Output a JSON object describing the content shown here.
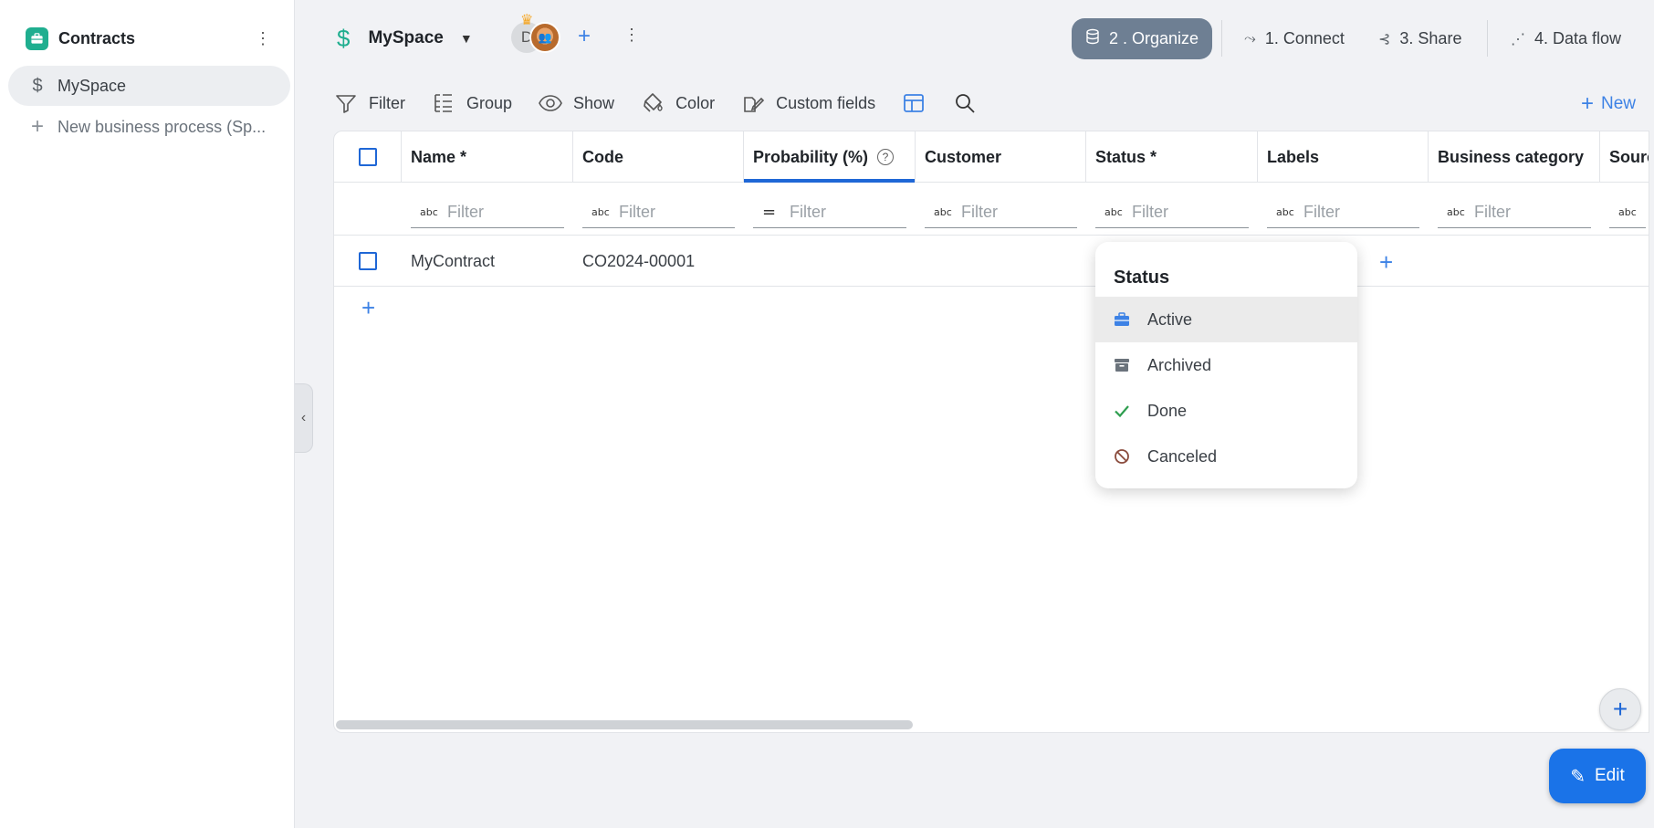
{
  "sidebar": {
    "title": "Contracts",
    "items": [
      {
        "label": "MySpace",
        "icon": "dollar-icon"
      },
      {
        "label": "New business process (Sp...",
        "icon": "plus-icon"
      }
    ]
  },
  "topbar": {
    "space_name": "MySpace",
    "avatar_initial": "D",
    "steps": [
      {
        "label": "2 . Organize",
        "icon": "database-icon",
        "active": true
      },
      {
        "label": "1. Connect",
        "icon": "connect-icon"
      },
      {
        "label": "3. Share",
        "icon": "share-icon"
      },
      {
        "label": "4. Data flow",
        "icon": "dataflow-icon"
      }
    ]
  },
  "toolbar": {
    "filter": "Filter",
    "group": "Group",
    "show": "Show",
    "color": "Color",
    "custom_fields": "Custom fields",
    "new": "New"
  },
  "table": {
    "columns": [
      "Name *",
      "Code",
      "Probability (%)",
      "Customer",
      "Status *",
      "Labels",
      "Business category",
      "Source"
    ],
    "filter_placeholder": "Filter",
    "rows": [
      {
        "name": "MyContract",
        "code": "CO2024-00001"
      }
    ]
  },
  "status_dropdown": {
    "title": "Status",
    "options": [
      {
        "label": "Active",
        "icon": "briefcase-icon",
        "color": "#3d82e5"
      },
      {
        "label": "Archived",
        "icon": "archive-icon",
        "color": "#6b737c"
      },
      {
        "label": "Done",
        "icon": "check-icon",
        "color": "#2e9e4f"
      },
      {
        "label": "Canceled",
        "icon": "block-icon",
        "color": "#8a4b3c"
      }
    ]
  },
  "edit_button": "Edit",
  "colors": {
    "accent": "#1a73e8",
    "brand": "#1fae8f",
    "organize": "#6e7f93"
  }
}
